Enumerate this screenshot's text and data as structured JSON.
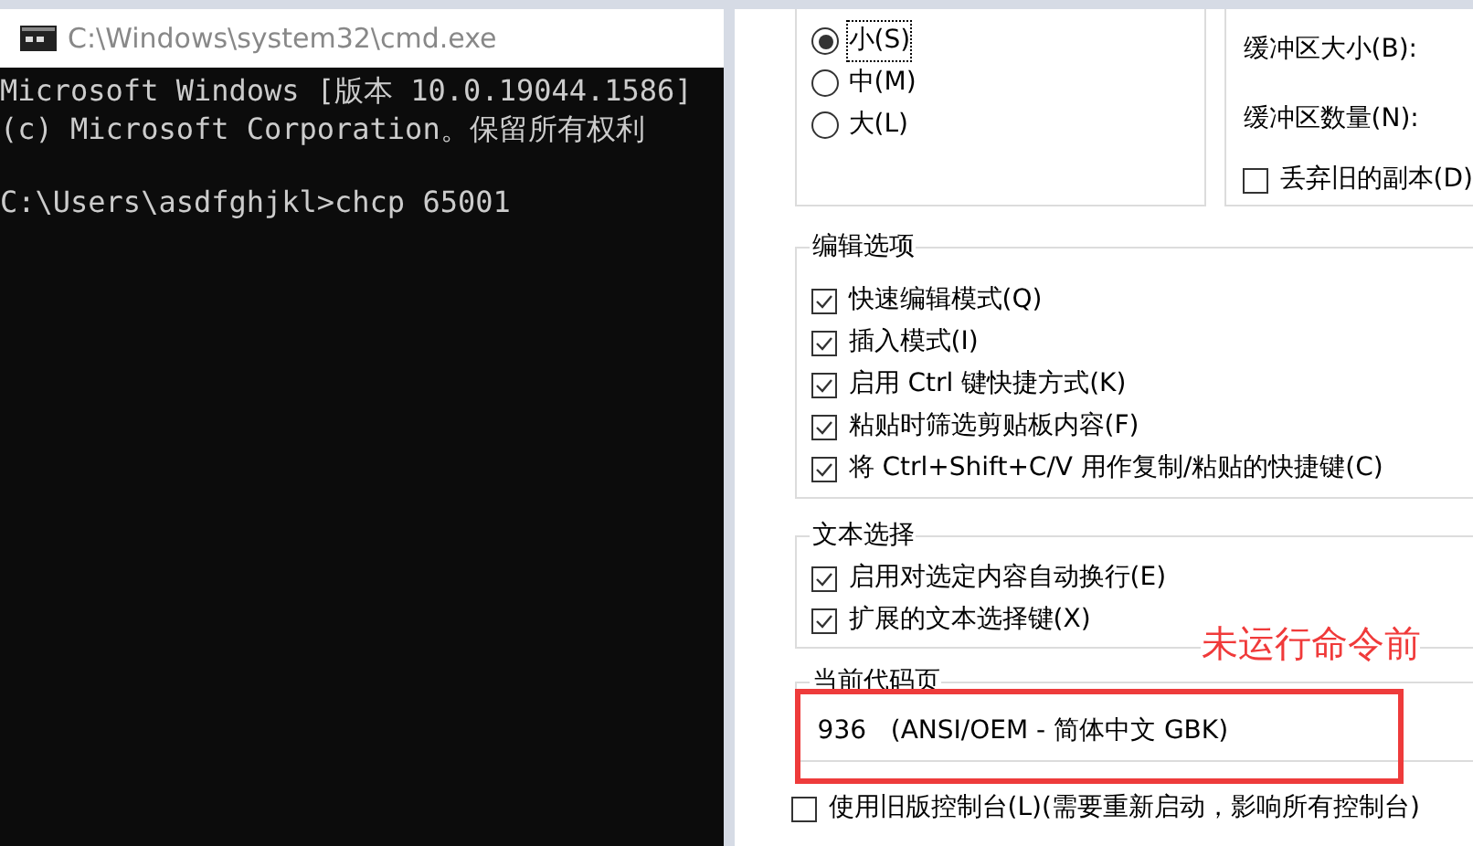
{
  "console_window": {
    "title": "C:\\Windows\\system32\\cmd.exe",
    "lines": [
      "Microsoft Windows [版本 10.0.19044.1586]",
      "(c) Microsoft Corporation。保留所有权利"
    ],
    "prompt": "C:\\Users\\asdfghjkl>chcp 65001"
  },
  "cursor_size": {
    "options": [
      {
        "label": "小(S)",
        "selected": true
      },
      {
        "label": "中(M)",
        "selected": false
      },
      {
        "label": "大(L)",
        "selected": false
      }
    ]
  },
  "buffer": {
    "size_label": "缓冲区大小(B):",
    "count_label": "缓冲区数量(N):",
    "discard": {
      "label": "丢弃旧的副本(D)",
      "checked": false
    }
  },
  "edit_options": {
    "title": "编辑选项",
    "items": [
      {
        "label": "快速编辑模式(Q)",
        "checked": true
      },
      {
        "label": "插入模式(I)",
        "checked": true
      },
      {
        "label": "启用 Ctrl 键快捷方式(K)",
        "checked": true
      },
      {
        "label": "粘贴时筛选剪贴板内容(F)",
        "checked": true
      },
      {
        "label": "将 Ctrl+Shift+C/V 用作复制/粘贴的快捷键(C)",
        "checked": true
      }
    ]
  },
  "text_selection": {
    "title": "文本选择",
    "items": [
      {
        "label": "启用对选定内容自动换行(E)",
        "checked": true
      },
      {
        "label": "扩展的文本选择键(X)",
        "checked": true
      }
    ]
  },
  "annotation": "未运行命令前",
  "code_page": {
    "title": "当前代码页",
    "value": "936   (ANSI/OEM - 简体中文 GBK)"
  },
  "legacy_console": {
    "label": "使用旧版控制台(L)(需要重新启动，影响所有控制台)",
    "checked": false
  }
}
